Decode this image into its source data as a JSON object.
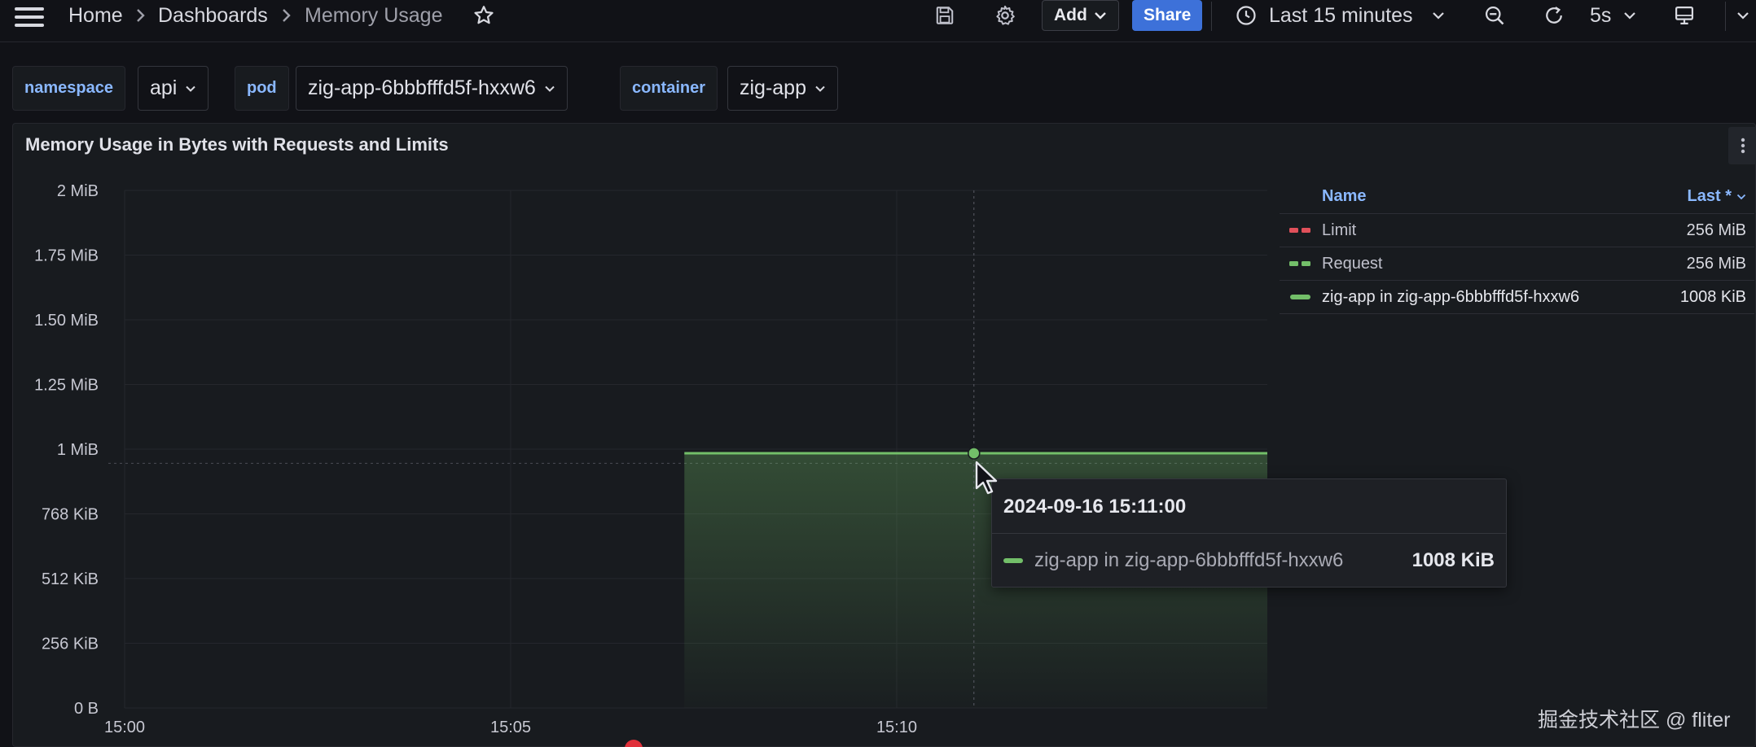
{
  "topbar": {
    "breadcrumbs": [
      "Home",
      "Dashboards",
      "Memory Usage"
    ],
    "add_label": "Add",
    "share_label": "Share",
    "time_range": "Last 15 minutes",
    "refresh_interval": "5s"
  },
  "variables": [
    {
      "label": "namespace",
      "value": "api"
    },
    {
      "label": "pod",
      "value": "zig-app-6bbbfffd5f-hxxw6"
    },
    {
      "label": "container",
      "value": "zig-app"
    }
  ],
  "panel": {
    "title": "Memory Usage in Bytes with Requests and Limits"
  },
  "legend": {
    "name_header": "Name",
    "last_header": "Last *",
    "rows": [
      {
        "name": "Limit",
        "value": "256 MiB",
        "color": "#e0505a",
        "style": "dashed"
      },
      {
        "name": "Request",
        "value": "256 MiB",
        "color": "#73bf69",
        "style": "dashed"
      },
      {
        "name": "zig-app in zig-app-6bbbfffd5f-hxxw6",
        "value": "1008 KiB",
        "color": "#73bf69",
        "style": "solid"
      }
    ]
  },
  "tooltip": {
    "time": "2024-09-16 15:11:00",
    "series": "zig-app in zig-app-6bbbfffd5f-hxxw6",
    "value": "1008 KiB"
  },
  "watermark": "掘金技术社区 @ fliter",
  "colors": {
    "series": "#73bf69",
    "limit": "#e0505a",
    "accent": "#3d71d9",
    "label": "#8ab8ff"
  },
  "chart_data": {
    "type": "area",
    "title": "Memory Usage in Bytes with Requests and Limits",
    "y_ticks": [
      {
        "label": "0 B",
        "value": 0
      },
      {
        "label": "256 KiB",
        "value": 256
      },
      {
        "label": "512 KiB",
        "value": 512
      },
      {
        "label": "768 KiB",
        "value": 768
      },
      {
        "label": "1 MiB",
        "value": 1024
      },
      {
        "label": "1.25 MiB",
        "value": 1280
      },
      {
        "label": "1.50 MiB",
        "value": 1536
      },
      {
        "label": "1.75 MiB",
        "value": 1792
      },
      {
        "label": "2 MiB",
        "value": 2048
      }
    ],
    "ylim": [
      0,
      2048
    ],
    "y_unit": "KiB",
    "x_ticks": [
      {
        "label": "15:00",
        "value": 0
      },
      {
        "label": "15:05",
        "value": 5
      },
      {
        "label": "15:10",
        "value": 10
      }
    ],
    "xlim": [
      0,
      14.8
    ],
    "x_unit": "minutes after 15:00",
    "series": [
      {
        "name": "zig-app in zig-app-6bbbfffd5f-hxxw6",
        "x": [
          7.25,
          14.8
        ],
        "y": [
          1008,
          1008
        ]
      }
    ],
    "hover": {
      "x": 11,
      "y": 1008
    },
    "reference_y": 968,
    "grid": true,
    "legend": "right"
  }
}
